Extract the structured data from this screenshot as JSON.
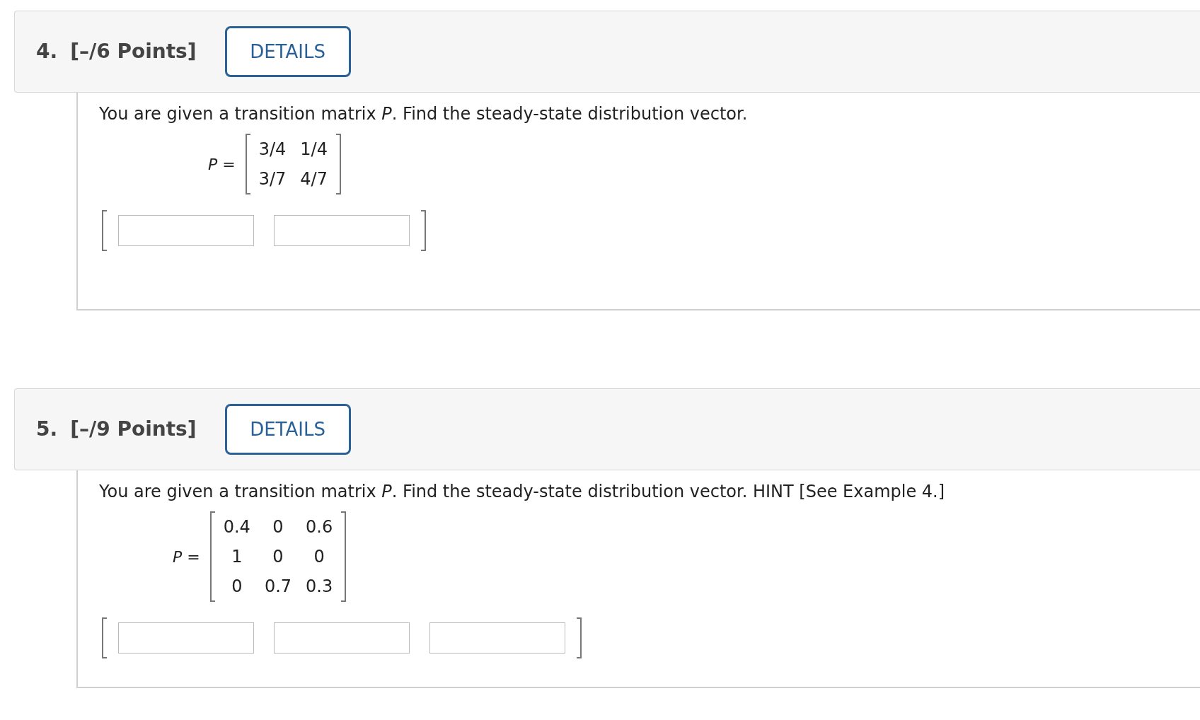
{
  "questions": [
    {
      "number": "4.",
      "points": "[–/6 Points]",
      "details_button": "DETAILS",
      "prompt": "You are given a transition matrix *P*. Find the steady-state distribution vector.",
      "matrix_label": "*P* =",
      "matrix": [
        [
          "3/4",
          "1/4"
        ],
        [
          "3/7",
          "4/7"
        ]
      ]
    },
    {
      "number": "5.",
      "points": "[–/9 Points]",
      "details_button": "DETAILS",
      "prompt": "You are given a transition matrix *P*. Find the steady-state distribution vector. HINT [See Example 4.]",
      "matrix_label": "*P* =",
      "matrix": [
        [
          "0.4",
          "0",
          "0.6"
        ],
        [
          "1",
          "0",
          "0"
        ],
        [
          "0",
          "0.7",
          "0.3"
        ]
      ]
    }
  ]
}
